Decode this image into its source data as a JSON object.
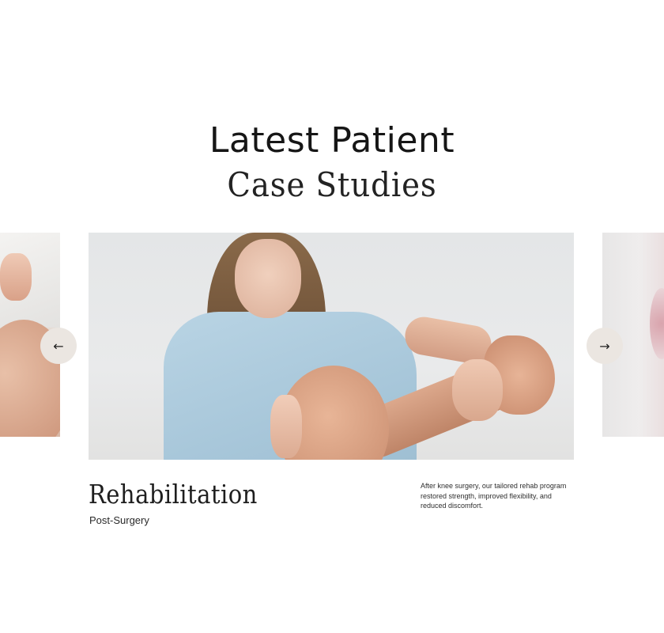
{
  "heading": {
    "line1": "Latest Patient",
    "line2": "Case Studies"
  },
  "carousel": {
    "prev_icon": "arrow-left-icon",
    "next_icon": "arrow-right-icon",
    "prev_glyph": "←",
    "next_glyph": "→",
    "button_color": "#ebe6e1"
  },
  "case": {
    "title": "Rehabilitation",
    "subtitle": "Post-Surgery",
    "description": "After knee surgery, our tailored rehab program restored strength, improved flexibility, and reduced discomfort."
  }
}
